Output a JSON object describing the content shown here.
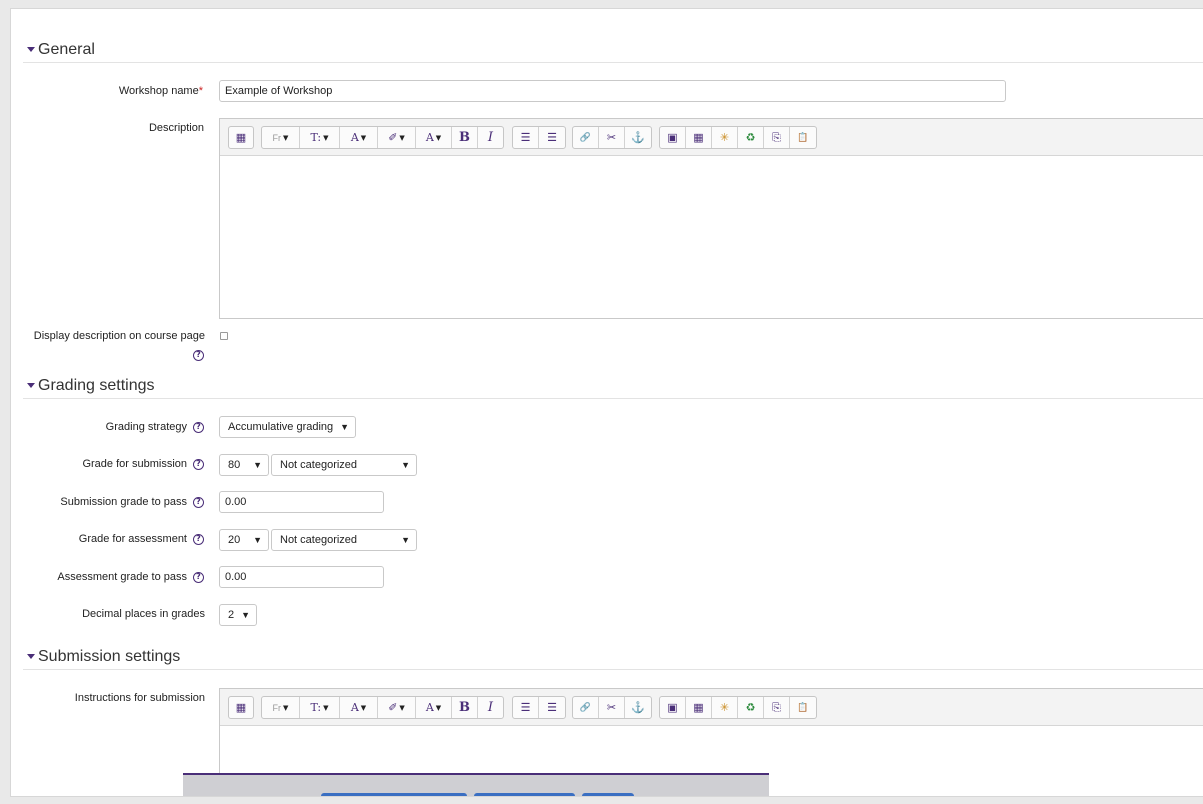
{
  "sections": {
    "general": "General",
    "grading": "Grading settings",
    "submission": "Submission settings"
  },
  "general": {
    "workshop_name_label": "Workshop name",
    "required_marker": "*",
    "workshop_name_value": "Example of Workshop",
    "description_label": "Description",
    "display_description_label": "Display description on course page",
    "display_description_checked": false
  },
  "editor_toolbar": {
    "font_family": "Fr",
    "font_size": "T:",
    "text_color": "A",
    "highlight": "✐",
    "styles": "A",
    "bold": "B",
    "italic": "I",
    "bullet_list": "☰",
    "numbered_list": "☰",
    "link": "🔗",
    "unlink": "✂",
    "anchor": "⚓",
    "image": "▣",
    "media": "▦",
    "emoticon": "✳",
    "recycle": "♻",
    "manage_files": "⎘",
    "paste": "📋"
  },
  "grading": {
    "strategy_label": "Grading strategy",
    "strategy_value": "Accumulative grading",
    "grade_submission_label": "Grade for submission",
    "grade_submission_value": "80",
    "grade_submission_category": "Not categorized",
    "submission_pass_label": "Submission grade to pass",
    "submission_pass_value": "0.00",
    "grade_assessment_label": "Grade for assessment",
    "grade_assessment_value": "20",
    "grade_assessment_category": "Not categorized",
    "assessment_pass_label": "Assessment grade to pass",
    "assessment_pass_value": "0.00",
    "decimal_label": "Decimal places in grades",
    "decimal_value": "2"
  },
  "submission": {
    "instructions_label": "Instructions for submission"
  },
  "colors": {
    "accent": "#4a2e78",
    "required": "#cc2222",
    "button_blue": "#3a6fc2"
  }
}
